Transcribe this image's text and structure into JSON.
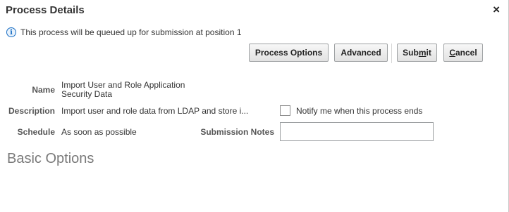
{
  "dialog": {
    "title": "Process Details",
    "close_label": "×"
  },
  "info": {
    "icon": "info-icon",
    "icon_glyph": "i",
    "message": "This process will be queued up for submission at position 1"
  },
  "toolbar": {
    "process_options_label": "Process Options",
    "advanced_label": "Advanced",
    "submit_label_pre": "Sub",
    "submit_label_mnemonic": "m",
    "submit_label_post": "it",
    "cancel_label_mnemonic": "C",
    "cancel_label_post": "ancel"
  },
  "form": {
    "name_label": "Name",
    "name_value_line1": "Import User and Role Application",
    "name_value_line2": "Security Data",
    "description_label": "Description",
    "description_value": "Import user and role data from LDAP and store i...",
    "notify_label": "Notify me when this process ends",
    "notify_checked": false,
    "schedule_label": "Schedule",
    "schedule_value": "As soon as possible",
    "submission_notes_label": "Submission Notes",
    "submission_notes_value": ""
  },
  "section": {
    "basic_options_title": "Basic Options"
  }
}
